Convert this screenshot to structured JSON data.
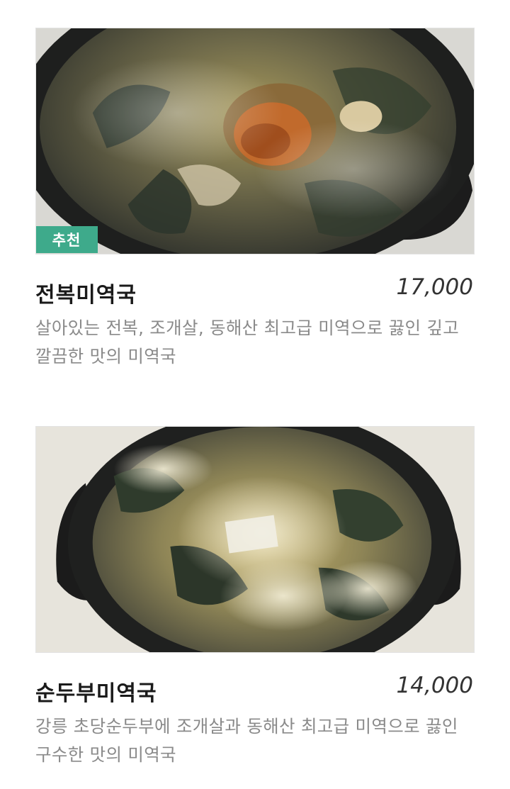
{
  "menu": {
    "items": [
      {
        "name": "전복미역국",
        "price": "17,000",
        "badge": "추천",
        "description": "살아있는 전복, 조개살, 동해산 최고급 미역으로 끓인 깊고 깔끔한 맛의 미역국",
        "image": "abalone-seaweed-soup-photo"
      },
      {
        "name": "순두부미역국",
        "price": "14,000",
        "description": "강릉 초당순두부에 조개살과 동해산 최고급 미역으로 끓인 구수한 맛의 미역국",
        "image": "soft-tofu-seaweed-soup-photo"
      }
    ]
  },
  "colors": {
    "badge": "#3eaa8b",
    "description": "#8a8a8a",
    "title": "#1a1a1a"
  }
}
